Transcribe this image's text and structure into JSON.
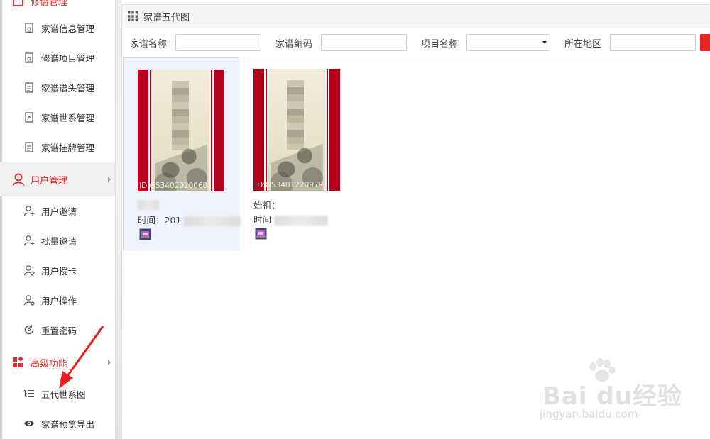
{
  "sidebar": {
    "top_group_label": "修谱管理",
    "items_top": [
      {
        "label": "家谱信息管理",
        "icon": "file-user-icon"
      },
      {
        "label": "修谱项目管理",
        "icon": "file-user-icon"
      },
      {
        "label": "家谱谱头管理",
        "icon": "document-icon"
      },
      {
        "label": "家谱世系管理",
        "icon": "file-tree-icon"
      },
      {
        "label": "家谱挂牌管理",
        "icon": "document-icon"
      }
    ],
    "user_group_label": "用户管理",
    "items_user": [
      {
        "label": "用户邀请",
        "icon": "user-add-icon"
      },
      {
        "label": "批量邀请",
        "icon": "user-add-icon"
      },
      {
        "label": "用户授卡",
        "icon": "user-check-icon"
      },
      {
        "label": "用户操作",
        "icon": "user-gear-icon"
      },
      {
        "label": "重置密码",
        "icon": "refresh-icon"
      }
    ],
    "advanced_group_label": "高级功能",
    "items_advanced": [
      {
        "label": "五代世系图",
        "icon": "list-tree-icon"
      },
      {
        "label": "家谱预览导出",
        "icon": "eye-icon"
      }
    ],
    "accent_color": "#e52a2a"
  },
  "panel": {
    "title": "家谱五代图"
  },
  "filters": {
    "name_label": "家谱名称",
    "name_value": "",
    "code_label": "家谱编码",
    "code_value": "",
    "project_label": "项目名称",
    "project_value": "",
    "region_label": "所在地区",
    "region_value": ""
  },
  "cards": [
    {
      "id_text": "ID:GS3402020060",
      "line1": "",
      "line2": "时间：201",
      "selected": true
    },
    {
      "id_text": "ID:GS3401220979",
      "line1": "始祖：",
      "line2": "时间",
      "selected": false
    }
  ],
  "watermark": {
    "main": "Bai du经验",
    "sub": "jingyan.baidu.com"
  }
}
